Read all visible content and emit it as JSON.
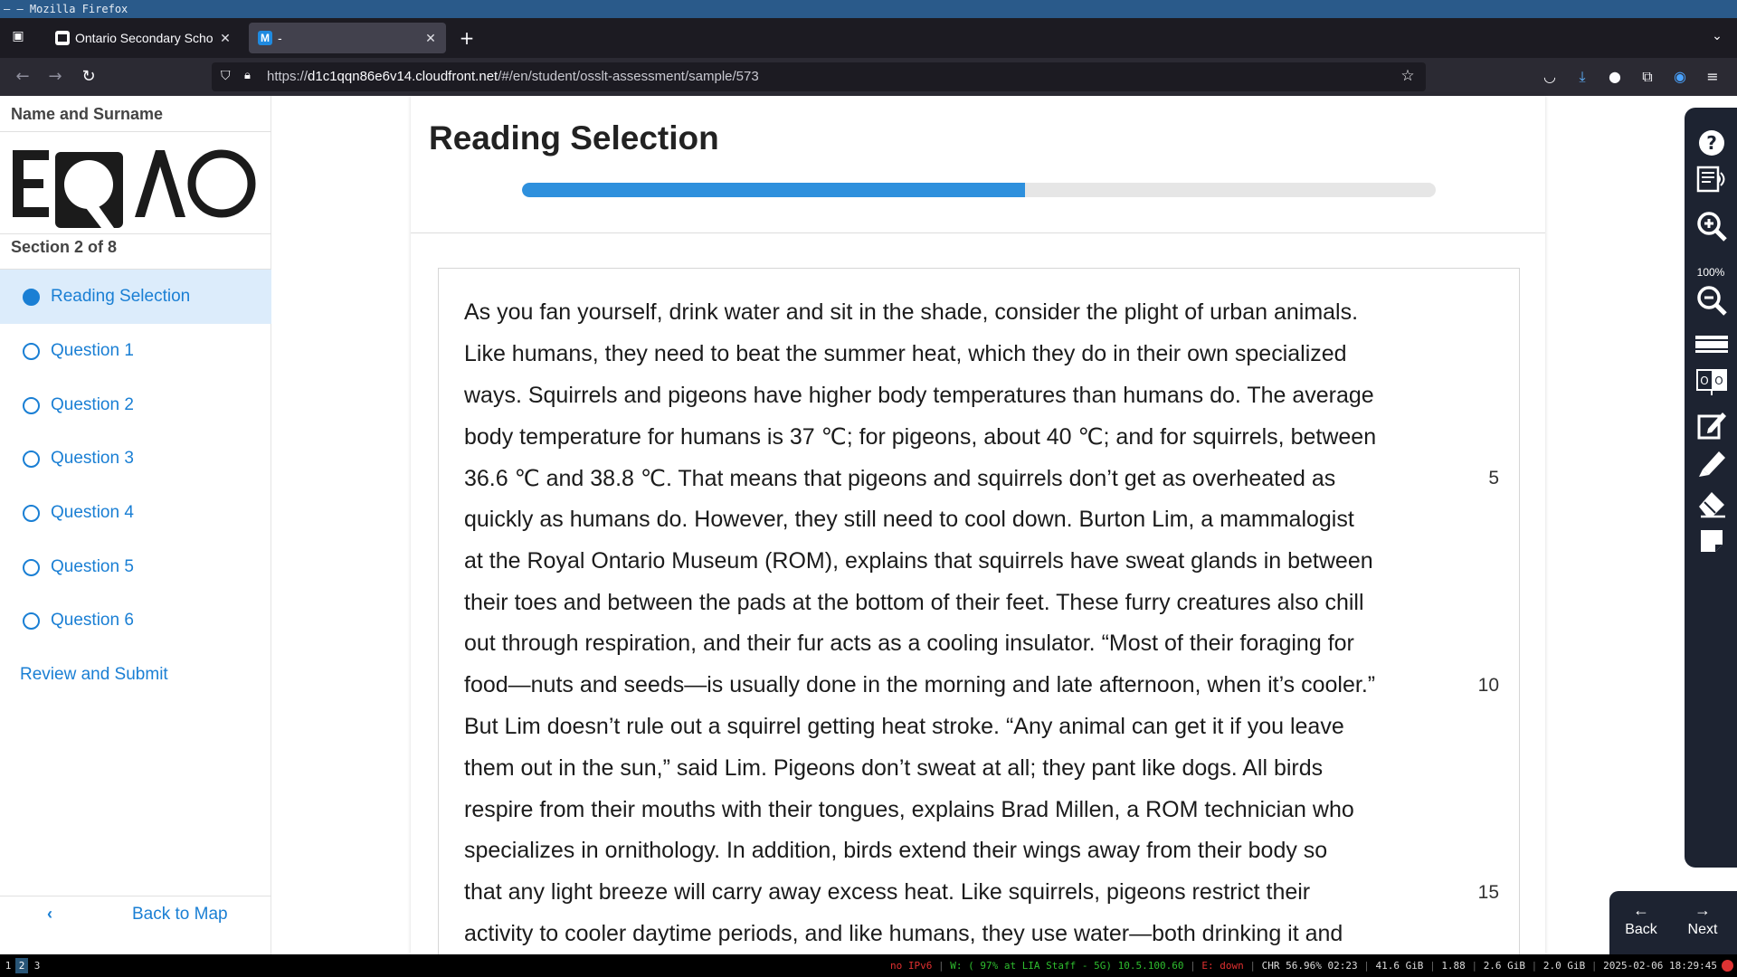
{
  "window": {
    "title": "– – Mozilla Firefox"
  },
  "browser": {
    "tabs": [
      {
        "title": "Ontario Secondary School Literacy Test",
        "favicon": "page-icon"
      },
      {
        "title": "-",
        "favicon": "m-logo-icon",
        "favicon_letter": "M"
      }
    ],
    "url_prefix": "https://",
    "url_host": "d1c1qqn86e6v14.cloudfront.net",
    "url_path": "/#/en/student/osslt-assessment/sample/573"
  },
  "sidebar": {
    "student_name": "Name and Surname",
    "logo_text": "EQAO",
    "section_label": "Section 2 of 8",
    "items": [
      {
        "label": "Reading Selection",
        "current": true
      },
      {
        "label": "Question 1"
      },
      {
        "label": "Question 2"
      },
      {
        "label": "Question 3"
      },
      {
        "label": "Question 4"
      },
      {
        "label": "Question 5"
      },
      {
        "label": "Question 6"
      }
    ],
    "review_label": "Review and Submit",
    "back_to_map_label": "Back to Map"
  },
  "main": {
    "title": "Reading Selection",
    "progress": 0.55,
    "passage_lines": [
      {
        "text": "As you fan yourself, drink water and sit in the shade, consider the plight of urban animals.",
        "no": ""
      },
      {
        "text": "Like humans, they need to beat the summer heat, which they do in their own specialized",
        "no": ""
      },
      {
        "text": "ways. Squirrels and pigeons have higher body temperatures than humans do. The average",
        "no": ""
      },
      {
        "text": "body temperature for humans is 37 ℃; for pigeons, about 40 ℃; and for squirrels, between",
        "no": ""
      },
      {
        "text": "36.6 ℃ and 38.8 ℃. That means that pigeons and squirrels don’t get as overheated as",
        "no": "5"
      },
      {
        "text": "quickly as humans do. However, they still need to cool down. Burton Lim, a mammalogist",
        "no": ""
      },
      {
        "text": "at the Royal Ontario Museum (ROM), explains that squirrels have sweat glands in between",
        "no": ""
      },
      {
        "text": "their toes and between the pads at the bottom of their feet. These furry creatures also chill",
        "no": ""
      },
      {
        "text": "out through respiration, and their fur acts as a cooling insulator. “Most of their foraging for",
        "no": ""
      },
      {
        "text": "food—nuts and seeds—is usually done in the morning and late afternoon, when it’s cooler.”",
        "no": "10"
      },
      {
        "text": "But Lim doesn’t rule out a squirrel getting heat stroke. “Any animal can get it if you leave",
        "no": ""
      },
      {
        "text": "them out in the sun,” said Lim. Pigeons don’t sweat at all; they pant like dogs. All birds",
        "no": ""
      },
      {
        "text": "respire from their mouths with their tongues, explains Brad Millen, a ROM technician who",
        "no": ""
      },
      {
        "text": "specializes in ornithology. In addition, birds extend their wings away from their body so",
        "no": ""
      },
      {
        "text": "that any light breeze will carry away excess heat. Like squirrels, pigeons restrict their",
        "no": "15"
      },
      {
        "text": "activity to cooler daytime periods, and like humans, they use water—both drinking it and",
        "no": ""
      }
    ]
  },
  "tools": {
    "zoom_level": "100%",
    "icons": [
      "help-icon",
      "text-to-speech-icon",
      "zoom-in-icon",
      "zoom-out-icon",
      "line-reader-icon",
      "high-contrast-icon",
      "notepad-icon",
      "highlighter-icon",
      "eraser-icon",
      "sticky-note-icon"
    ]
  },
  "pager": {
    "back_label": "Back",
    "next_label": "Next"
  },
  "statusbar": {
    "workspaces": [
      "1",
      "2",
      "3"
    ],
    "active_workspace": "2",
    "ipv6": "no IPv6",
    "wifi": "W: ( 97% at LIA Staff - 5G) 10.5.100.60",
    "ethernet": "E: down",
    "cpu": "CHR 56.96% 02:23",
    "disk": "41.6 GiB",
    "load": "1.88",
    "mem1": "2.6 GiB",
    "mem2": "2.0 GiB",
    "datetime": "2025-02-06 18:29:45"
  },
  "colors": {
    "accent": "#1a7fd4",
    "progress": "#2e90dd",
    "rail": "#1d2331"
  }
}
